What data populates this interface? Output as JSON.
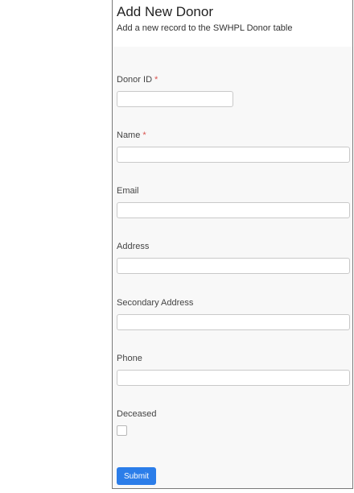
{
  "header": {
    "title": "Add New Donor",
    "subtitle": "Add a new record to the SWHPL Donor table"
  },
  "fields": {
    "donor_id": {
      "label": "Donor ID",
      "required_mark": "*",
      "value": ""
    },
    "name": {
      "label": "Name",
      "required_mark": "*",
      "value": ""
    },
    "email": {
      "label": "Email",
      "value": ""
    },
    "address": {
      "label": "Address",
      "value": ""
    },
    "secondary_address": {
      "label": "Secondary Address",
      "value": ""
    },
    "phone": {
      "label": "Phone",
      "value": ""
    },
    "deceased": {
      "label": "Deceased",
      "checked": false
    }
  },
  "actions": {
    "submit_label": "Submit"
  },
  "colors": {
    "accent": "#2b7de9",
    "required": "#d9534f",
    "panel_bg": "#f8f8f8"
  }
}
